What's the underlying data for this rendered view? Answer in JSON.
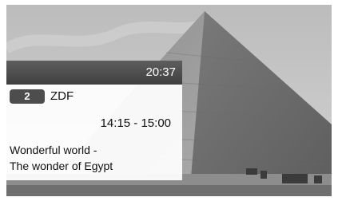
{
  "osd": {
    "clock": "20:37",
    "channel_number": "2",
    "channel_name": "ZDF",
    "time_slot": "14:15 - 15:00",
    "program_title_line1": "Wonderful world -",
    "program_title_line2": "The wonder of Egypt"
  },
  "background": {
    "scene": "pyramid-photo",
    "colors": {
      "sky": "#c4c4c4",
      "pyramid_light": "#9a9a9a",
      "pyramid_dark": "#6e6e6e",
      "ground": "#8c8c8c"
    }
  },
  "colors": {
    "header_bg": "#4a4a4a",
    "body_bg": "#ffffff",
    "badge_bg": "#4d4d4d",
    "text_dark": "#111111",
    "text_light": "#ffffff"
  }
}
